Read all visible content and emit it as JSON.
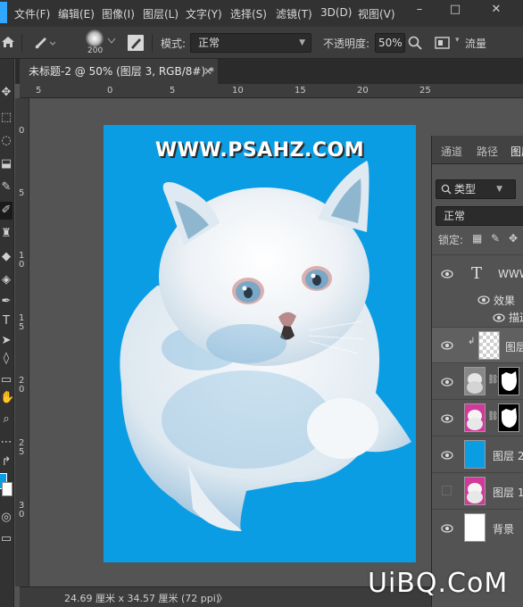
{
  "menubar": {
    "items": [
      "文件(F)",
      "编辑(E)",
      "图像(I)",
      "图层(L)",
      "文字(Y)",
      "选择(S)",
      "滤镜(T)",
      "3D(D)",
      "视图(V)"
    ],
    "window_controls": [
      "–",
      "□",
      "✕"
    ]
  },
  "options": {
    "brush_size": "200",
    "mode_label": "模式:",
    "mode_value": "正常",
    "opacity_label": "不透明度:",
    "opacity_value": "50%",
    "flow_label": "流量"
  },
  "document": {
    "tab_title": "未标题-2 @ 50% (图层 3, RGB/8#) *",
    "tab_close": "✕",
    "background_color": "#0b9de3",
    "watermark_text": "WWW.PSAHZ.COM"
  },
  "rulers": {
    "horizontal": [
      "5",
      "0",
      "5",
      "10",
      "15",
      "20",
      "25"
    ],
    "vertical": [
      "0",
      "5",
      "1 0",
      "1 5",
      "2 0",
      "2 5",
      "3 0"
    ]
  },
  "status": {
    "text": "24.69 厘米 x 34.57 厘米 (72 ppi)",
    "arrow": "〉"
  },
  "panel": {
    "tabs": [
      "通道",
      "路径",
      "图层"
    ],
    "filter_label": "类型",
    "blend_value": "正常",
    "lock_label": "锁定:",
    "layers": [
      {
        "name": "WWW",
        "kind": "text",
        "visible": true
      },
      {
        "name": "效果",
        "kind": "effects",
        "visible": true
      },
      {
        "name": "描边",
        "kind": "effect-item",
        "visible": true
      },
      {
        "name": "图层",
        "kind": "transparent",
        "visible": true
      },
      {
        "name": "",
        "kind": "masked-gray",
        "visible": true
      },
      {
        "name": "",
        "kind": "masked-pink",
        "visible": true
      },
      {
        "name": "图层 2",
        "kind": "blue",
        "visible": true
      },
      {
        "name": "图层 1",
        "kind": "pink",
        "visible": false
      },
      {
        "name": "背景",
        "kind": "white",
        "visible": true
      }
    ]
  },
  "site_watermark": "UiBQ.CoM"
}
